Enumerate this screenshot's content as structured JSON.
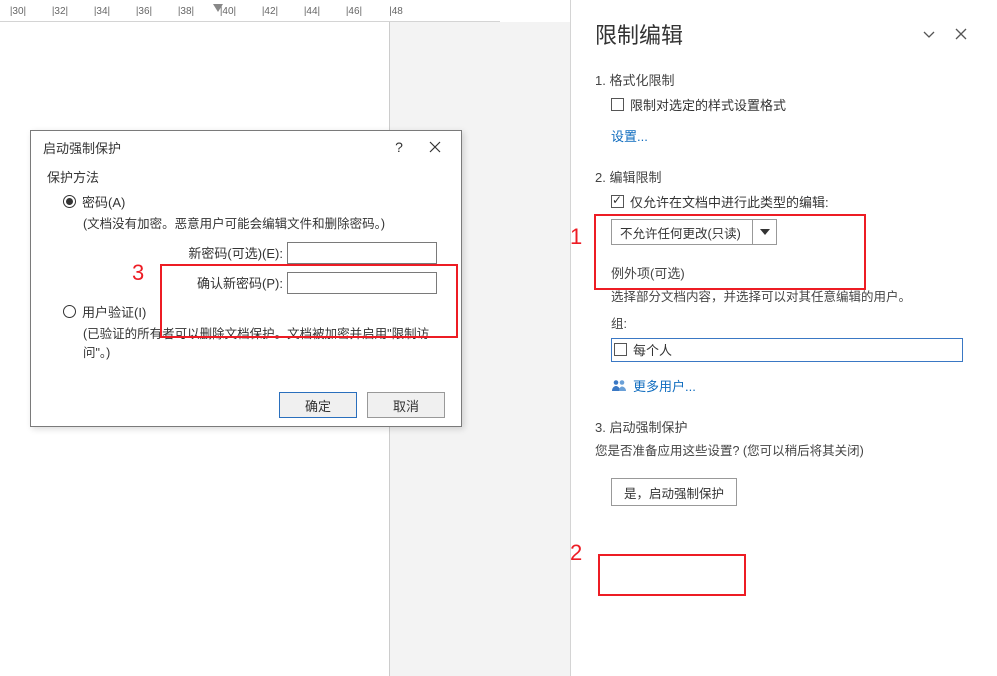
{
  "ruler": {
    "ticks": [
      "|30|",
      "|32|",
      "|34|",
      "|36|",
      "|38|",
      "|40|",
      "|42|",
      "|44|",
      "|46|",
      "|48"
    ]
  },
  "dialog": {
    "title": "启动强制保护",
    "help": "?",
    "group_label": "保护方法",
    "radio_password": "密码(A)",
    "password_desc": "(文档没有加密。恶意用户可能会编辑文件和删除密码。)",
    "new_pw_label": "新密码(可选)(E):",
    "confirm_pw_label": "确认新密码(P):",
    "radio_userauth": "用户验证(I)",
    "userauth_desc": "(已验证的所有者可以删除文档保护。文档被加密并启用\"限制访问\"。)",
    "ok": "确定",
    "cancel": "取消"
  },
  "annotations": {
    "n1": "1",
    "n2": "2",
    "n3": "3"
  },
  "panel": {
    "title": "限制编辑",
    "s1_heading": "1. 格式化限制",
    "s1_checkbox": "限制对选定的样式设置格式",
    "s1_settings": "设置...",
    "s2_heading": "2. 编辑限制",
    "s2_checkbox": "仅允许在文档中进行此类型的编辑:",
    "s2_dropdown_value": "不允许任何更改(只读)",
    "exceptions_label": "例外项(可选)",
    "exceptions_desc": "选择部分文档内容，并选择可以对其任意编辑的用户。",
    "groups_label": "组:",
    "group_everyone": "每个人",
    "more_users": "更多用户...",
    "s3_heading": "3. 启动强制保护",
    "s3_desc": "您是否准备应用这些设置? (您可以稍后将其关闭)",
    "s3_button": "是，启动强制保护"
  }
}
